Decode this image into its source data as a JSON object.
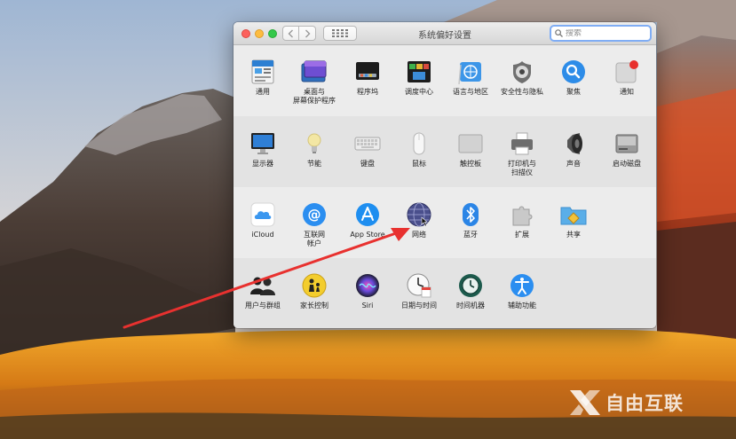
{
  "window": {
    "title": "系统偏好设置",
    "search_placeholder": "搜索"
  },
  "sections": [
    {
      "items": [
        {
          "label": "通用",
          "icon": "general-icon"
        },
        {
          "label": "桌面与\n屏幕保护程序",
          "icon": "desktop-screensaver-icon"
        },
        {
          "label": "程序坞",
          "icon": "dock-icon"
        },
        {
          "label": "调度中心",
          "icon": "mission-control-icon"
        },
        {
          "label": "语言与地区",
          "icon": "language-region-icon"
        },
        {
          "label": "安全性与隐私",
          "icon": "security-privacy-icon"
        },
        {
          "label": "聚焦",
          "icon": "spotlight-icon"
        },
        {
          "label": "通知",
          "icon": "notifications-icon"
        }
      ]
    },
    {
      "items": [
        {
          "label": "显示器",
          "icon": "displays-icon"
        },
        {
          "label": "节能",
          "icon": "energy-saver-icon"
        },
        {
          "label": "键盘",
          "icon": "keyboard-icon"
        },
        {
          "label": "鼠标",
          "icon": "mouse-icon"
        },
        {
          "label": "触控板",
          "icon": "trackpad-icon"
        },
        {
          "label": "打印机与\n扫描仪",
          "icon": "printers-scanners-icon"
        },
        {
          "label": "声音",
          "icon": "sound-icon"
        },
        {
          "label": "启动磁盘",
          "icon": "startup-disk-icon"
        }
      ]
    },
    {
      "items": [
        {
          "label": "iCloud",
          "icon": "icloud-icon"
        },
        {
          "label": "互联网\n帐户",
          "icon": "internet-accounts-icon"
        },
        {
          "label": "App Store",
          "icon": "app-store-icon"
        },
        {
          "label": "网络",
          "icon": "network-icon"
        },
        {
          "label": "蓝牙",
          "icon": "bluetooth-icon"
        },
        {
          "label": "扩展",
          "icon": "extensions-icon"
        },
        {
          "label": "共享",
          "icon": "sharing-icon"
        }
      ]
    },
    {
      "items": [
        {
          "label": "用户与群组",
          "icon": "users-groups-icon"
        },
        {
          "label": "家长控制",
          "icon": "parental-controls-icon"
        },
        {
          "label": "Siri",
          "icon": "siri-icon"
        },
        {
          "label": "日期与时间",
          "icon": "date-time-icon"
        },
        {
          "label": "时间机器",
          "icon": "time-machine-icon"
        },
        {
          "label": "辅助功能",
          "icon": "accessibility-icon"
        }
      ]
    }
  ],
  "watermark": {
    "text": "自由互联"
  },
  "colors": {
    "window_bg": "#ececec",
    "search_focus": "#7fadf5",
    "annotation_arrow": "#e8312f"
  }
}
